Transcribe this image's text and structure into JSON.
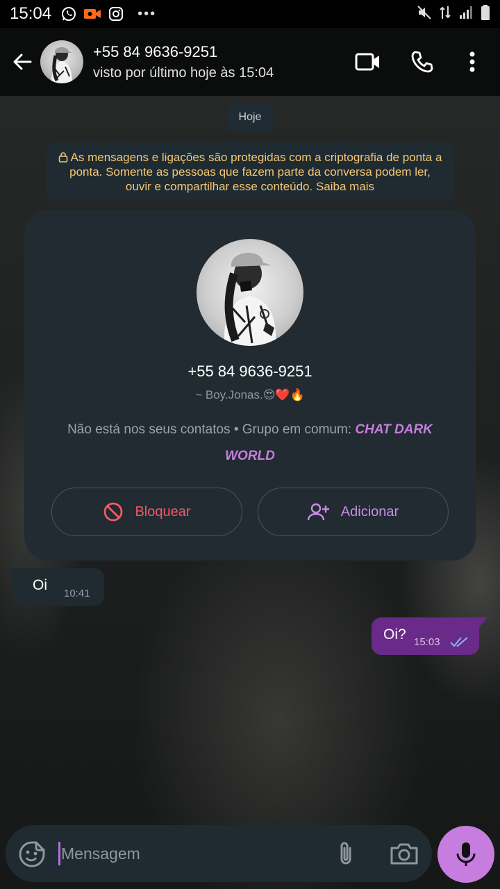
{
  "status_bar": {
    "time": "15:04",
    "dots": "•••"
  },
  "header": {
    "contact_number": "+55 84 9636-9251",
    "last_seen": "visto por último hoje às 15:04"
  },
  "date_chip": "Hoje",
  "encryption_notice": "As mensagens e ligações são protegidas com a criptografia de ponta a ponta. Somente as pessoas que fazem parte da conversa podem ler, ouvir e compartilhar esse conteúdo. Saiba mais",
  "contact_card": {
    "number": "+55 84 9636-9251",
    "push_name": "~ Boy.Jonas.😍❤️🔥",
    "desc_prefix": "Não está nos seus contatos • Grupo em comum: ",
    "group_name": "CHAT DARK WORLD",
    "block_label": "Bloquear",
    "add_label": "Adicionar"
  },
  "messages": [
    {
      "direction": "in",
      "text": "Oi",
      "time": "10:41"
    },
    {
      "direction": "out",
      "text": "Oi?",
      "time": "15:03",
      "status": "read"
    }
  ],
  "composer": {
    "placeholder": "Mensagem"
  },
  "colors": {
    "accent": "#c77ddf",
    "outgoing_bubble": "#6a2a8a",
    "incoming_bubble": "#1f2b31",
    "block_red": "#ef5b68",
    "notice_yellow": "#f5c774",
    "read_ticks": "#8ab4ff"
  },
  "icons": {
    "status_apps": [
      "whatsapp-icon",
      "video-recorder-icon",
      "instagram-icon"
    ],
    "status_system": [
      "mute-icon",
      "data-arrows-icon",
      "signal-icon",
      "battery-icon"
    ],
    "header_actions": [
      "video-call-icon",
      "phone-icon",
      "more-vert-icon"
    ]
  }
}
